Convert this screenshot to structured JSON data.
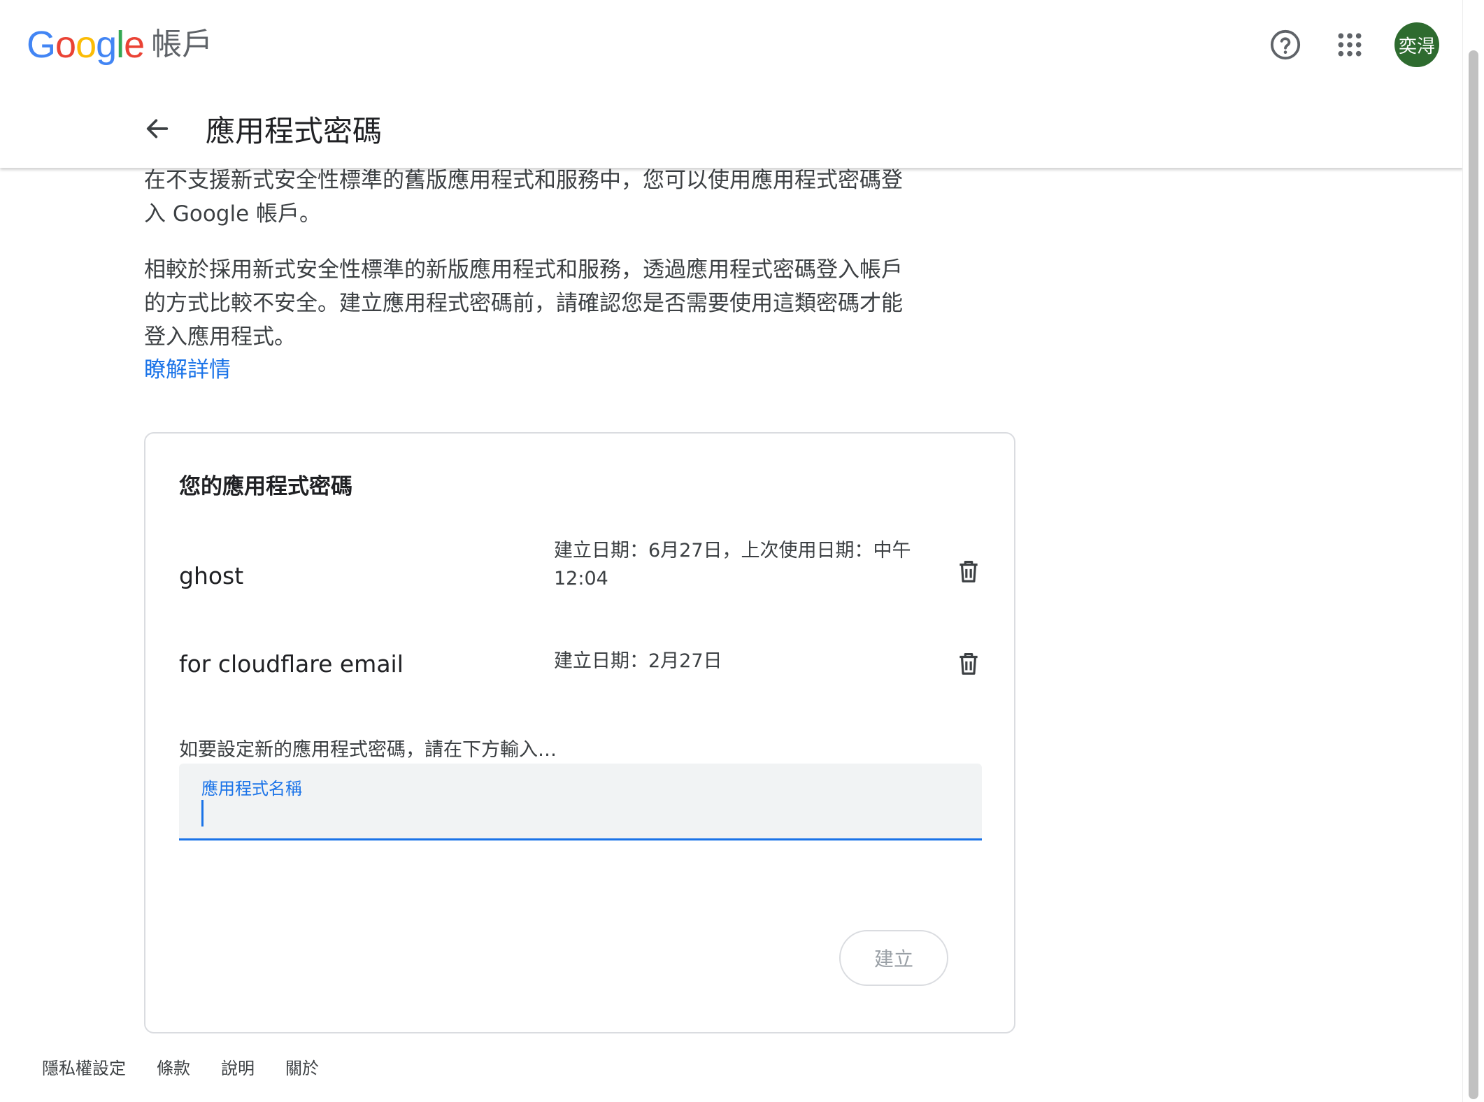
{
  "header": {
    "logo_letters": [
      "G",
      "o",
      "o",
      "g",
      "l",
      "e"
    ],
    "product_name": "帳戶",
    "icons": {
      "help": "help-circle-icon",
      "apps": "apps-grid-icon"
    },
    "avatar_text": "奕淂",
    "avatar_color": "#2e6b2f"
  },
  "page": {
    "title": "應用程式密碼",
    "intro_1": "在不支援新式安全性標準的舊版應用程式和服務中，您可以使用應用程式密碼登入 Google 帳戶。",
    "intro_2": "相較於採用新式安全性標準的新版應用程式和服務，透過應用程式密碼登入帳戶的方式比較不安全。建立應用程式密碼前，請確認您是否需要使用這類密碼才能登入應用程式。",
    "learn_more": "瞭解詳情"
  },
  "card": {
    "title": "您的應用程式密碼",
    "passwords": [
      {
        "name": "ghost",
        "meta": "建立日期：6月27日，上次使用日期：中午 12:04"
      },
      {
        "name": "for cloudflare email",
        "meta": "建立日期：2月27日"
      }
    ],
    "new_hint": "如要設定新的應用程式密碼，請在下方輸入…",
    "field_label": "應用程式名稱",
    "field_value": "",
    "create_label": "建立"
  },
  "footer": {
    "links": [
      "隱私權設定",
      "條款",
      "說明",
      "關於"
    ]
  },
  "colors": {
    "accent": "#1a73e8",
    "google_blue": "#4285f4",
    "google_red": "#ea4335",
    "google_yellow": "#fbbc05",
    "google_green": "#34a853"
  }
}
